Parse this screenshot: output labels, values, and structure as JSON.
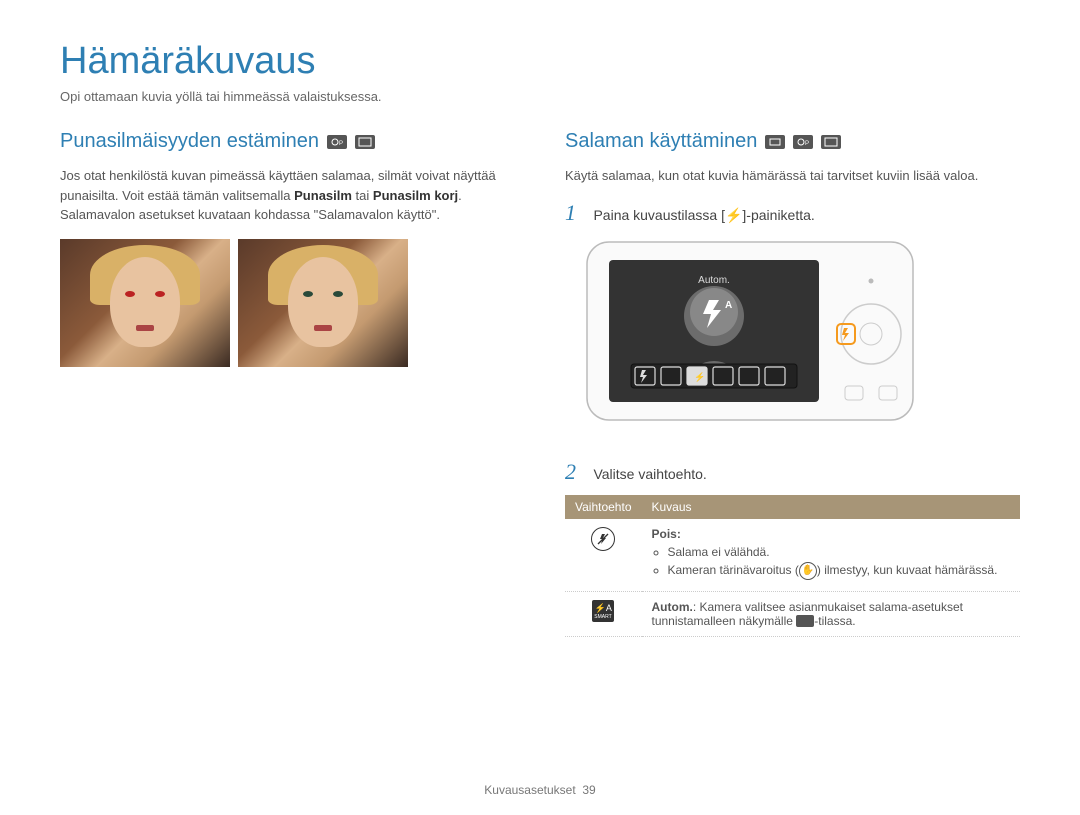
{
  "title": "Hämäräkuvaus",
  "subtitle": "Opi ottamaan kuvia yöllä tai himmeässä valaistuksessa.",
  "left": {
    "heading": "Punasilmäisyyden estäminen",
    "body_pre": "Jos otat henkilöstä kuvan pimeässä käyttäen salamaa, silmät voivat näyttää punaisilta. Voit estää tämän valitsemalla ",
    "bold1": "Punasilm",
    "body_mid": " tai ",
    "bold2": "Punasilm korj",
    "body_post": ". Salamavalon asetukset kuvataan kohdassa \"Salamavalon käyttö\"."
  },
  "right": {
    "heading": "Salaman käyttäminen",
    "intro": "Käytä salamaa, kun otat kuvia hämärässä tai tarvitset kuviin lisää valoa.",
    "step1_pre": "Paina kuvaustilassa [",
    "step1_post": "]-painiketta.",
    "screen_label": "Autom.",
    "step2": "Valitse vaihtoehto.",
    "table": {
      "col1": "Vaihtoehto",
      "col2": "Kuvaus",
      "row1": {
        "title": "Pois:",
        "b1": "Salama ei välähdä.",
        "b2_pre": "Kameran tärinävaroitus (",
        "b2_post": ") ilmestyy, kun kuvaat hämärässä."
      },
      "row2": {
        "bold": "Autom.",
        "text_pre": ": Kamera valitsee asianmukaiset salama-asetukset tunnistamalleen näkymälle ",
        "text_post": "-tilassa."
      }
    }
  },
  "footer": {
    "section": "Kuvausasetukset",
    "page": "39"
  }
}
